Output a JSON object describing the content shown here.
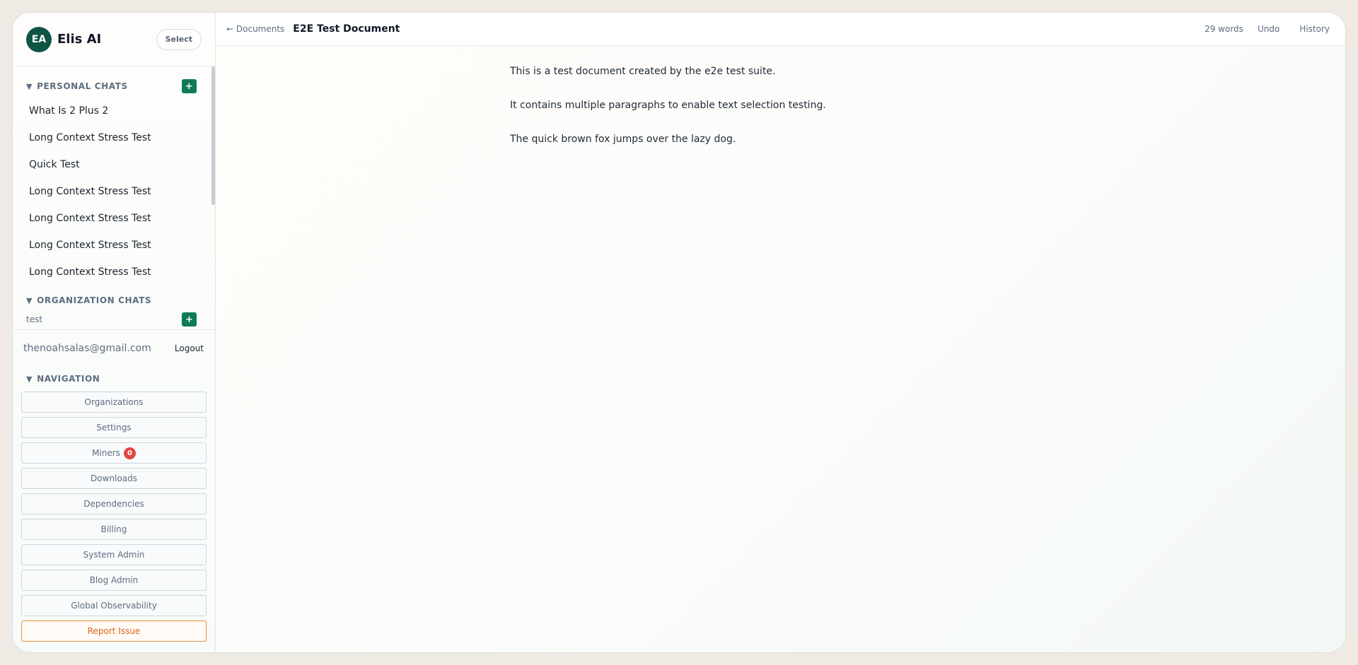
{
  "brand": {
    "avatar_initials": "EA",
    "name": "Elis AI",
    "select_label": "Select"
  },
  "personal_chats": {
    "title": "PERSONAL CHATS",
    "add_label": "+",
    "items": [
      "What Is 2 Plus 2",
      "Long Context Stress Test",
      "Quick Test",
      "Long Context Stress Test",
      "Long Context Stress Test",
      "Long Context Stress Test",
      "Long Context Stress Test"
    ]
  },
  "organization_chats": {
    "title": "ORGANIZATION CHATS",
    "add_label": "+",
    "items": [
      "test"
    ]
  },
  "user": {
    "email": "thenoahsalas@gmail.com",
    "logout_label": "Logout"
  },
  "navigation": {
    "title": "NAVIGATION",
    "items": [
      "Organizations",
      "Settings",
      "Miners",
      "Downloads",
      "Dependencies",
      "Billing",
      "System Admin",
      "Blog Admin",
      "Global Observability"
    ],
    "miners_badge": "0",
    "report_label": "Report Issue"
  },
  "topbar": {
    "back_label": "← Documents",
    "doc_title": "E2E Test Document",
    "word_count": "29 words",
    "undo_label": "Undo",
    "history_label": "History"
  },
  "document": {
    "paragraphs": [
      "This is a test document created by the e2e test suite.",
      "It contains multiple paragraphs to enable text selection testing.",
      "The quick brown fox jumps over the lazy dog."
    ]
  },
  "colors": {
    "accent": "#0f7a58",
    "avatar": "#0f5546",
    "badge": "#e34343",
    "report": "#d9651a"
  }
}
